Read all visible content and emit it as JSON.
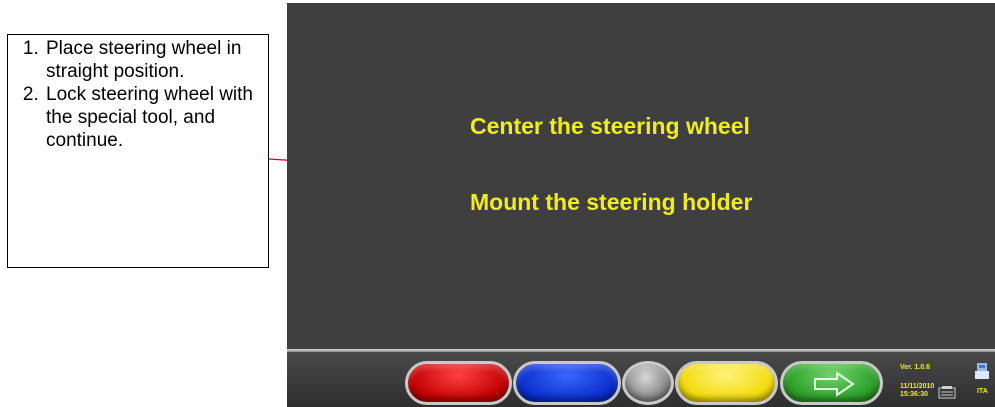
{
  "callout": {
    "steps": [
      "Place steering wheel in straight position.",
      "Lock steering wheel with the special tool, and continue."
    ]
  },
  "screen": {
    "message_1": "Center the steering wheel",
    "message_2": "Mount the steering holder"
  },
  "bottom_bar": {
    "buttons": [
      {
        "name": "red",
        "color": "#c00000"
      },
      {
        "name": "blue",
        "color": "#0a2ecc"
      },
      {
        "name": "gray",
        "color": "#8a8a8a"
      },
      {
        "name": "yellow",
        "color": "#f2dc10"
      },
      {
        "name": "green-next",
        "color": "#2ea02a",
        "icon": "right-arrow-icon"
      }
    ],
    "version": "Ver. 1.0.6",
    "date": "11/11/2010",
    "time": "15:36:30",
    "language": "ITA",
    "icons": [
      "tool-icon",
      "language-icon"
    ]
  },
  "colors": {
    "screen_background": "#3f3f3f",
    "message_text": "#f2ec1c",
    "pointer_arrow": "#e00000"
  }
}
